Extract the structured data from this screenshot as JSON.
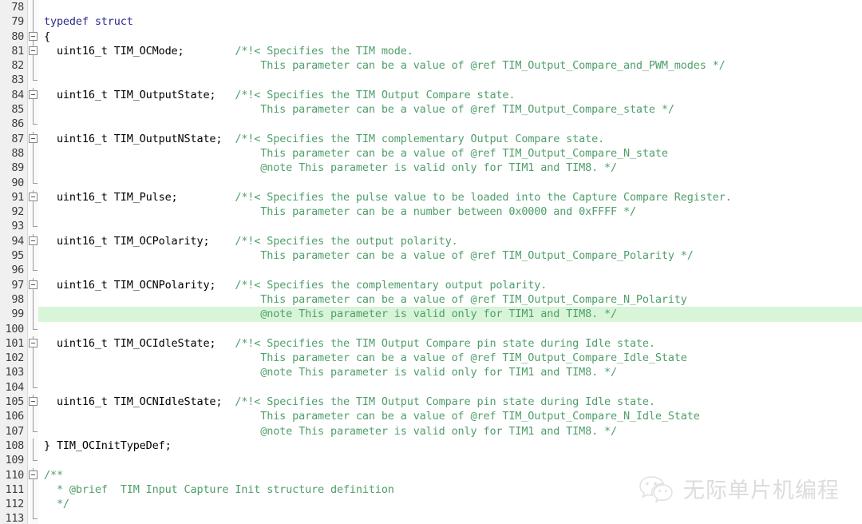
{
  "editor": {
    "language": "c",
    "first_visible_line": 78,
    "last_visible_line": 113,
    "highlighted_line": 99,
    "colors": {
      "background": "#ffffff",
      "gutter_background": "#f0f0f0",
      "line_number": "#3c3c3c",
      "keyword": "#2b2b8f",
      "plain_text": "#000000",
      "comment": "#4f9e6a",
      "current_line_highlight": "#d8f5d8"
    },
    "lines": [
      {
        "num": "78",
        "fold": "line",
        "segments": []
      },
      {
        "num": "79",
        "fold": "line",
        "segments": [
          {
            "cls": "kw",
            "text": "typedef struct"
          }
        ]
      },
      {
        "num": "80",
        "fold": "box",
        "segments": [
          {
            "cls": "plain",
            "text": "{"
          }
        ]
      },
      {
        "num": "81",
        "fold": "box",
        "segments": [
          {
            "cls": "plain",
            "text": "  uint16_t TIM_OCMode;        "
          },
          {
            "cls": "comment",
            "text": "/*!< Specifies the TIM mode."
          }
        ]
      },
      {
        "num": "82",
        "fold": "line",
        "segments": [
          {
            "cls": "comment",
            "text": "                                  This parameter can be a value of @ref TIM_Output_Compare_and_PWM_modes */"
          }
        ]
      },
      {
        "num": "83",
        "fold": "end",
        "segments": []
      },
      {
        "num": "84",
        "fold": "box",
        "segments": [
          {
            "cls": "plain",
            "text": "  uint16_t TIM_OutputState;   "
          },
          {
            "cls": "comment",
            "text": "/*!< Specifies the TIM Output Compare state."
          }
        ]
      },
      {
        "num": "85",
        "fold": "line",
        "segments": [
          {
            "cls": "comment",
            "text": "                                  This parameter can be a value of @ref TIM_Output_Compare_state */"
          }
        ]
      },
      {
        "num": "86",
        "fold": "end",
        "segments": []
      },
      {
        "num": "87",
        "fold": "box",
        "segments": [
          {
            "cls": "plain",
            "text": "  uint16_t TIM_OutputNState;  "
          },
          {
            "cls": "comment",
            "text": "/*!< Specifies the TIM complementary Output Compare state."
          }
        ]
      },
      {
        "num": "88",
        "fold": "line",
        "segments": [
          {
            "cls": "comment",
            "text": "                                  This parameter can be a value of @ref TIM_Output_Compare_N_state"
          }
        ]
      },
      {
        "num": "89",
        "fold": "line",
        "segments": [
          {
            "cls": "comment",
            "text": "                                  @note This parameter is valid only for TIM1 and TIM8. */"
          }
        ]
      },
      {
        "num": "90",
        "fold": "end",
        "segments": []
      },
      {
        "num": "91",
        "fold": "box",
        "segments": [
          {
            "cls": "plain",
            "text": "  uint16_t TIM_Pulse;         "
          },
          {
            "cls": "comment",
            "text": "/*!< Specifies the pulse value to be loaded into the Capture Compare Register."
          }
        ]
      },
      {
        "num": "92",
        "fold": "line",
        "segments": [
          {
            "cls": "comment",
            "text": "                                  This parameter can be a number between 0x0000 and 0xFFFF */"
          }
        ]
      },
      {
        "num": "93",
        "fold": "end",
        "segments": []
      },
      {
        "num": "94",
        "fold": "box",
        "segments": [
          {
            "cls": "plain",
            "text": "  uint16_t TIM_OCPolarity;    "
          },
          {
            "cls": "comment",
            "text": "/*!< Specifies the output polarity."
          }
        ]
      },
      {
        "num": "95",
        "fold": "line",
        "segments": [
          {
            "cls": "comment",
            "text": "                                  This parameter can be a value of @ref TIM_Output_Compare_Polarity */"
          }
        ]
      },
      {
        "num": "96",
        "fold": "end",
        "segments": []
      },
      {
        "num": "97",
        "fold": "box",
        "segments": [
          {
            "cls": "plain",
            "text": "  uint16_t TIM_OCNPolarity;   "
          },
          {
            "cls": "comment",
            "text": "/*!< Specifies the complementary output polarity."
          }
        ]
      },
      {
        "num": "98",
        "fold": "line",
        "segments": [
          {
            "cls": "comment",
            "text": "                                  This parameter can be a value of @ref TIM_Output_Compare_N_Polarity"
          }
        ]
      },
      {
        "num": "99",
        "fold": "line",
        "highlight": true,
        "segments": [
          {
            "cls": "comment",
            "text": "                                  @note This parameter is valid only for TIM1 and TIM8. */"
          }
        ]
      },
      {
        "num": "100",
        "fold": "end",
        "segments": []
      },
      {
        "num": "101",
        "fold": "box",
        "segments": [
          {
            "cls": "plain",
            "text": "  uint16_t TIM_OCIdleState;   "
          },
          {
            "cls": "comment",
            "text": "/*!< Specifies the TIM Output Compare pin state during Idle state."
          }
        ]
      },
      {
        "num": "102",
        "fold": "line",
        "segments": [
          {
            "cls": "comment",
            "text": "                                  This parameter can be a value of @ref TIM_Output_Compare_Idle_State"
          }
        ]
      },
      {
        "num": "103",
        "fold": "line",
        "segments": [
          {
            "cls": "comment",
            "text": "                                  @note This parameter is valid only for TIM1 and TIM8. */"
          }
        ]
      },
      {
        "num": "104",
        "fold": "end",
        "segments": []
      },
      {
        "num": "105",
        "fold": "box",
        "segments": [
          {
            "cls": "plain",
            "text": "  uint16_t TIM_OCNIdleState;  "
          },
          {
            "cls": "comment",
            "text": "/*!< Specifies the TIM Output Compare pin state during Idle state."
          }
        ]
      },
      {
        "num": "106",
        "fold": "line",
        "segments": [
          {
            "cls": "comment",
            "text": "                                  This parameter can be a value of @ref TIM_Output_Compare_N_Idle_State"
          }
        ]
      },
      {
        "num": "107",
        "fold": "end",
        "segments": [
          {
            "cls": "comment",
            "text": "                                  @note This parameter is valid only for TIM1 and TIM8. */"
          }
        ]
      },
      {
        "num": "108",
        "fold": "line",
        "segments": [
          {
            "cls": "plain",
            "text": "} TIM_OCInitTypeDef;"
          }
        ]
      },
      {
        "num": "109",
        "fold": "end",
        "segments": []
      },
      {
        "num": "110",
        "fold": "box",
        "segments": [
          {
            "cls": "comment",
            "text": "/**"
          }
        ]
      },
      {
        "num": "111",
        "fold": "line",
        "segments": [
          {
            "cls": "comment",
            "text": "  * @brief  TIM Input Capture Init structure definition"
          }
        ]
      },
      {
        "num": "112",
        "fold": "line",
        "segments": [
          {
            "cls": "comment",
            "text": "  */"
          }
        ]
      },
      {
        "num": "113",
        "fold": "end",
        "segments": []
      }
    ]
  },
  "watermark": {
    "text": "无际单片机编程",
    "logo": "wechat-icon"
  }
}
